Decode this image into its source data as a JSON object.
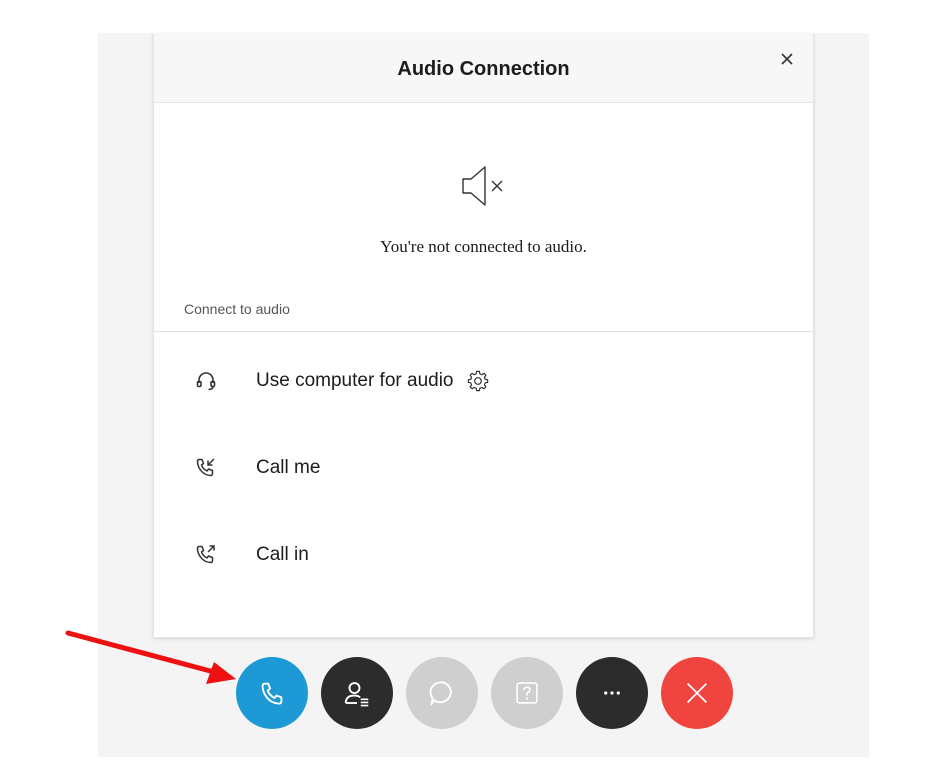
{
  "dialog": {
    "title": "Audio Connection",
    "status_text": "You're not connected to audio.",
    "section_label": "Connect to audio",
    "options": [
      {
        "label": "Use computer for audio",
        "icon": "headset-icon"
      },
      {
        "label": "Call me",
        "icon": "call-me-icon"
      },
      {
        "label": "Call in",
        "icon": "call-in-icon"
      }
    ]
  },
  "toolbar": {
    "buttons": [
      {
        "name": "audio",
        "icon": "phone-icon",
        "color": "#1d9ad6"
      },
      {
        "name": "participants",
        "icon": "participants-icon",
        "color": "#2c2c2c"
      },
      {
        "name": "chat",
        "icon": "chat-icon",
        "color": "#cfcfcf"
      },
      {
        "name": "qa",
        "icon": "question-icon",
        "color": "#cfcfcf"
      },
      {
        "name": "more",
        "icon": "more-icon",
        "color": "#2c2c2c"
      },
      {
        "name": "leave",
        "icon": "close-icon",
        "color": "#f0453f"
      }
    ]
  },
  "annotation": {
    "arrow_color": "#ee1111"
  }
}
